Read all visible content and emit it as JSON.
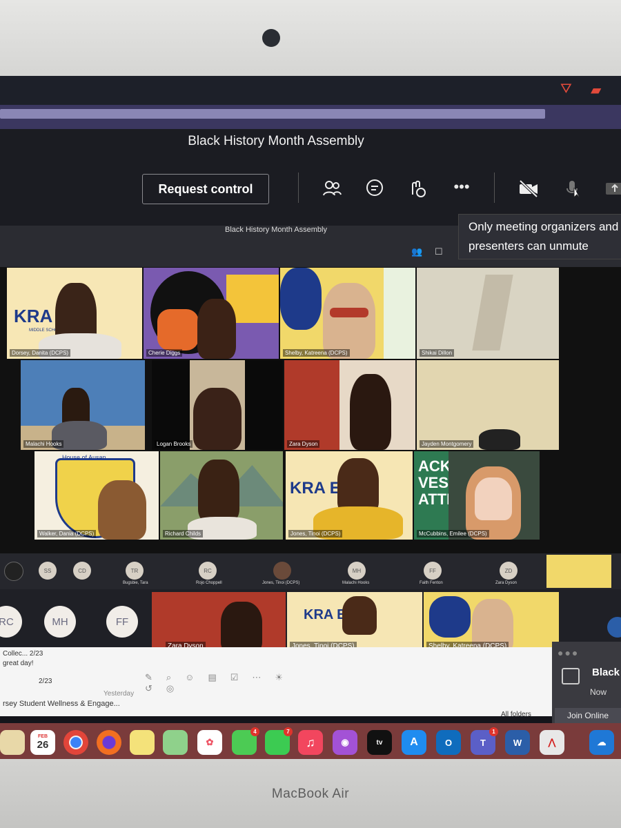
{
  "meeting": {
    "title": "Black History Month Assembly",
    "subtitle": "Black History Month Assembly",
    "request_control_label": "Request control",
    "tooltip": "Only meeting organizers and presenters can unmute"
  },
  "toolbar_icons": [
    "people-icon",
    "chat-icon",
    "reactions-icon",
    "more-icon",
    "camera-off-icon",
    "mic-icon",
    "share-icon"
  ],
  "participants": [
    {
      "name": "Dorsey, Danita (DCPS)"
    },
    {
      "name": "Cherie Diggs"
    },
    {
      "name": "Shelby, Katreena (DCPS)"
    },
    {
      "name": "Shikai Dillon"
    },
    {
      "name": "Malachi Hooks"
    },
    {
      "name": "Logan Brooks"
    },
    {
      "name": "Zara Dyson"
    },
    {
      "name": "Jayden Montgomery"
    },
    {
      "name": "Walker, Dania (DCPS)"
    },
    {
      "name": "Richard Childs"
    },
    {
      "name": "Jones, Tinoi (DCPS)"
    },
    {
      "name": "McCubbins, Emilee (DCPS)"
    }
  ],
  "tile_text": {
    "kramer": "KRA   ER",
    "middle_school": "MIDDLE        SCHOOL",
    "black_lives": "ACK\nVES\nATTER",
    "house": "House of Ausan"
  },
  "strip": [
    {
      "initials": "SS"
    },
    {
      "initials": "CD"
    },
    {
      "initials": "TR",
      "label": "Bugsbie, Tara"
    },
    {
      "initials": "RC",
      "label": "Rojo Choppell"
    },
    {
      "initials": "",
      "label": "Jones, Tinoi (DCPS)"
    },
    {
      "initials": "MH",
      "label": "Malachi Hooks"
    },
    {
      "initials": "FF",
      "label": "Faith Fenton"
    },
    {
      "initials": "ZD",
      "label": "Zara Dyson"
    }
  ],
  "lower": {
    "avatars": [
      "RC",
      "MH",
      "FF"
    ],
    "tiles": [
      "Zara Dyson",
      "Jones, Tinoi (DCPS)",
      "Shelby, Katreena (DCPS)"
    ]
  },
  "outlook": {
    "line1": "Collec... 2/23",
    "line2": "great day!",
    "date": "2/23",
    "yesterday": "Yesterday",
    "folder": "rsey Student Wellness & Engage...",
    "all_folders": "All folders"
  },
  "notification": {
    "title": "Black",
    "time": "Now",
    "action": "Join Online"
  },
  "dock": {
    "calendar_month": "FEB",
    "calendar_day": "26",
    "badges": {
      "messages": "4",
      "facetime": "7",
      "teams": "1"
    },
    "apps": [
      "Finder",
      "Calendar",
      "Chrome",
      "Firefox",
      "Notes",
      "Maps",
      "Photos",
      "Messages",
      "FaceTime",
      "Music",
      "Podcasts",
      "TV",
      "App Store",
      "Outlook",
      "Teams",
      "Word",
      "Acrobat",
      "OneDrive"
    ]
  },
  "laptop": {
    "brand": "MacBook Air"
  }
}
